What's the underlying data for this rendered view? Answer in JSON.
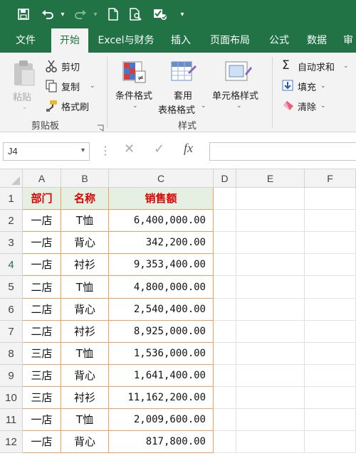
{
  "colors": {
    "brand": "#217346",
    "header_text": "#e00000",
    "header_fill": "#e6f0e2",
    "table_border": "#f0a060"
  },
  "qat": {
    "icons": [
      "save-icon",
      "undo-icon",
      "redo-icon",
      "new-file-icon",
      "print-preview-icon",
      "check-spell-icon",
      "customize-icon"
    ]
  },
  "tabs": [
    "文件",
    "开始",
    "Excel与财务",
    "插入",
    "页面布局",
    "公式",
    "数据",
    "审"
  ],
  "active_tab": "开始",
  "clipboard": {
    "paste": "粘贴",
    "cut": "剪切",
    "copy": "复制",
    "format_painter": "格式刷",
    "label": "剪贴板"
  },
  "styles": {
    "conditional_formatting": "条件格式",
    "format_as_table_line1": "套用",
    "format_as_table_line2": "表格格式",
    "cell_styles": "单元格样式",
    "label": "样式"
  },
  "editing": {
    "autosum": "自动求和",
    "fill": "填充",
    "clear": "清除"
  },
  "formula_bar": {
    "name_box": "J4",
    "fx": "fx",
    "formula": ""
  },
  "columns": [
    "A",
    "B",
    "C",
    "D",
    "E",
    "F"
  ],
  "rows": [
    "1",
    "2",
    "3",
    "4",
    "5",
    "6",
    "7",
    "8",
    "9",
    "10",
    "11",
    "12"
  ],
  "table": {
    "header": [
      "部门",
      "名称",
      "销售额"
    ],
    "body": [
      [
        "一店",
        "T恤",
        "6,400,000.00"
      ],
      [
        "一店",
        "背心",
        "342,200.00"
      ],
      [
        "一店",
        "衬衫",
        "9,353,400.00"
      ],
      [
        "二店",
        "T恤",
        "4,800,000.00"
      ],
      [
        "二店",
        "背心",
        "2,540,400.00"
      ],
      [
        "二店",
        "衬衫",
        "8,925,000.00"
      ],
      [
        "三店",
        "T恤",
        "1,536,000.00"
      ],
      [
        "三店",
        "背心",
        "1,641,400.00"
      ],
      [
        "三店",
        "衬衫",
        "11,162,200.00"
      ],
      [
        "一店",
        "T恤",
        "2,009,600.00"
      ],
      [
        "一店",
        "背心",
        "817,800.00"
      ]
    ]
  }
}
